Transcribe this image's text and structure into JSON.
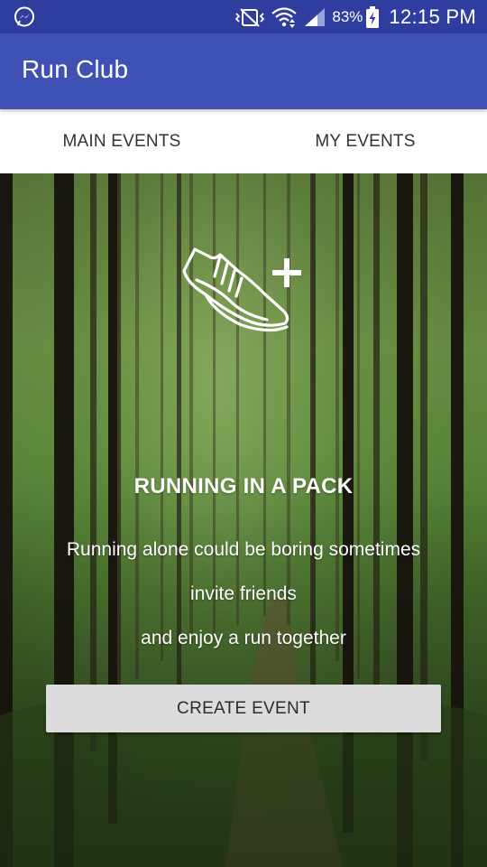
{
  "status_bar": {
    "left_icon": "messenger-icon",
    "icons": [
      "vibrate-icon",
      "wifi-icon",
      "signal-icon",
      "battery-charging-icon"
    ],
    "battery_percent": "83%",
    "time": "12:15 PM"
  },
  "app_bar": {
    "title": "Run Club",
    "color": "#3f51b5"
  },
  "tabs": [
    {
      "label": "MAIN EVENTS"
    },
    {
      "label": "MY EVENTS"
    }
  ],
  "hero": {
    "icon": "running-shoe-plus-icon",
    "title": "RUNNING IN A PACK",
    "lines": [
      "Running alone could be boring sometimes",
      "invite friends",
      "and enjoy a run together"
    ]
  },
  "create_button": {
    "label": "CREATE EVENT",
    "color": "#dcdcdc"
  },
  "colors": {
    "status_bar": "#2f3e9e",
    "primary": "#3f51b5",
    "tab_background": "#ffffff"
  }
}
